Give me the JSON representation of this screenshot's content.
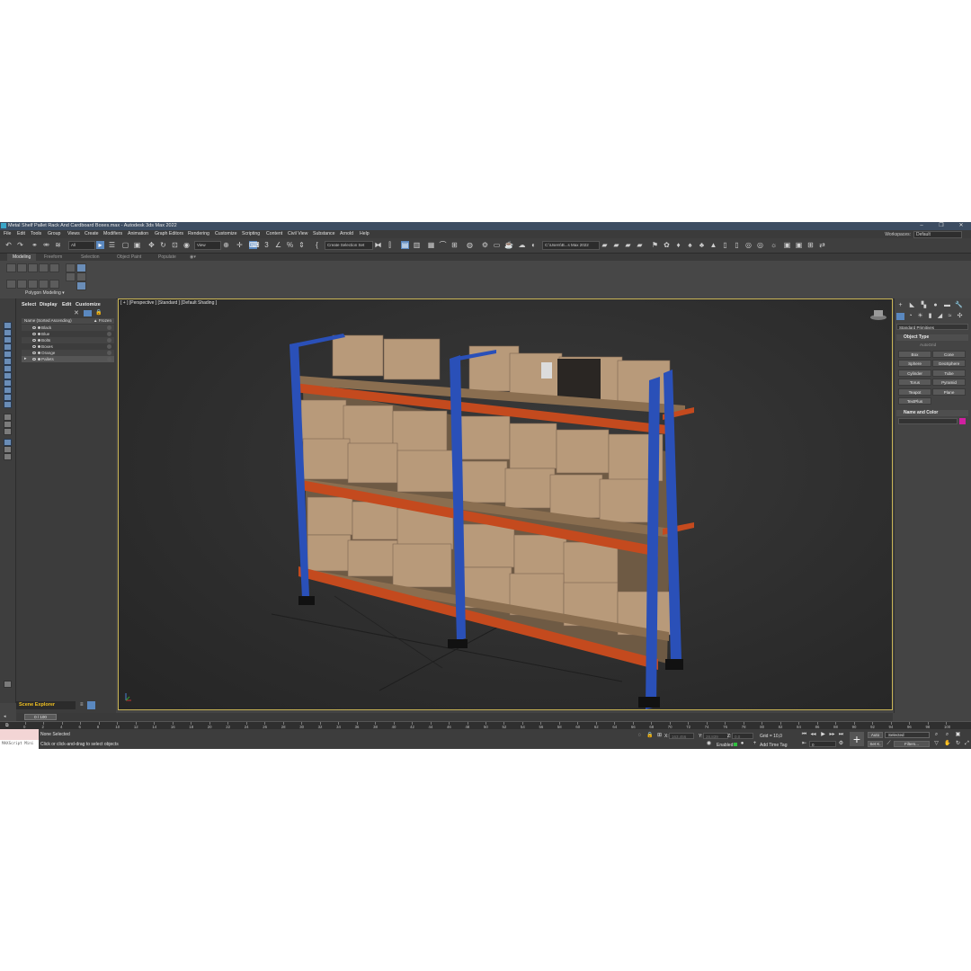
{
  "window": {
    "title": "Metal Shelf Pallet Rack And Cardboard Boxes.max - Autodesk 3ds Max 2022",
    "controls": [
      "–",
      "❐",
      "✕"
    ]
  },
  "menubar": {
    "items": [
      "File",
      "Edit",
      "Tools",
      "Group",
      "Views",
      "Create",
      "Modifiers",
      "Animation",
      "Graph Editors",
      "Rendering",
      "Customize",
      "Scripting",
      "Content",
      "Civil View",
      "Substance",
      "Arnold",
      "Help"
    ],
    "workspace_label": "Workspaces:",
    "workspace_value": "Default"
  },
  "toolbar": {
    "filter_value": "All",
    "view_value": "View",
    "selection_set": "Create Selection Set",
    "path_value": "C:\\Users\\B...s Max 2022"
  },
  "ribbon": {
    "tabs": [
      "Modeling",
      "Freeform",
      "Selection",
      "Object Paint",
      "Populate"
    ],
    "active_tab": "Modeling",
    "group_label": "Polygon Modeling ▾"
  },
  "scene_explorer": {
    "menu": [
      "Select",
      "Display",
      "Edit",
      "Customize"
    ],
    "column_name": "Name (Sorted Ascending)",
    "column_frozen": "▲ Frozen",
    "rows": [
      "Black",
      "Blue",
      "Bolts",
      "Boxes",
      "Orange",
      "Pallets"
    ],
    "label": "Scene Explorer"
  },
  "viewport": {
    "label": "[ + ] [Perspective ] [Standard ] [Default Shading ]"
  },
  "command_panel": {
    "dropdown": "Standard Primitives",
    "object_type_title": "Object Type",
    "autogrid": "AutoGrid",
    "buttons": [
      "Box",
      "Cone",
      "Sphere",
      "GeoSphere",
      "Cylinder",
      "Tube",
      "Torus",
      "Pyramid",
      "Teapot",
      "Plane",
      "TextPlus"
    ],
    "name_color_title": "Name and Color",
    "object_color": "#d020a0"
  },
  "timeline": {
    "frame_display": "0 / 100",
    "ticks": [
      "0",
      "2",
      "4",
      "6",
      "8",
      "10",
      "12",
      "14",
      "16",
      "18",
      "20",
      "22",
      "24",
      "26",
      "28",
      "30",
      "32",
      "34",
      "36",
      "38",
      "40",
      "42",
      "44",
      "46",
      "48",
      "50",
      "52",
      "54",
      "56",
      "58",
      "60",
      "62",
      "64",
      "66",
      "68",
      "70",
      "72",
      "74",
      "76",
      "78",
      "80",
      "82",
      "84",
      "86",
      "88",
      "90",
      "92",
      "94",
      "96",
      "98",
      "100"
    ]
  },
  "status": {
    "maxscript": "MAXScript Mini",
    "selection": "None Selected",
    "prompt": "Click or click-and-drag to select objects",
    "x_label": "X:",
    "y_label": "Y:",
    "z_label": "Z:",
    "x_placeholder": "163,456",
    "y_placeholder": "28,839",
    "z_placeholder": "0,0",
    "grid": "Grid = 10,0",
    "enabled": "Enabled:",
    "add_time_tag": "Add Time Tag",
    "auto": "Auto",
    "selected": "Selected",
    "set_k": "Set K.",
    "filters": "Filters...",
    "frame": "0"
  }
}
